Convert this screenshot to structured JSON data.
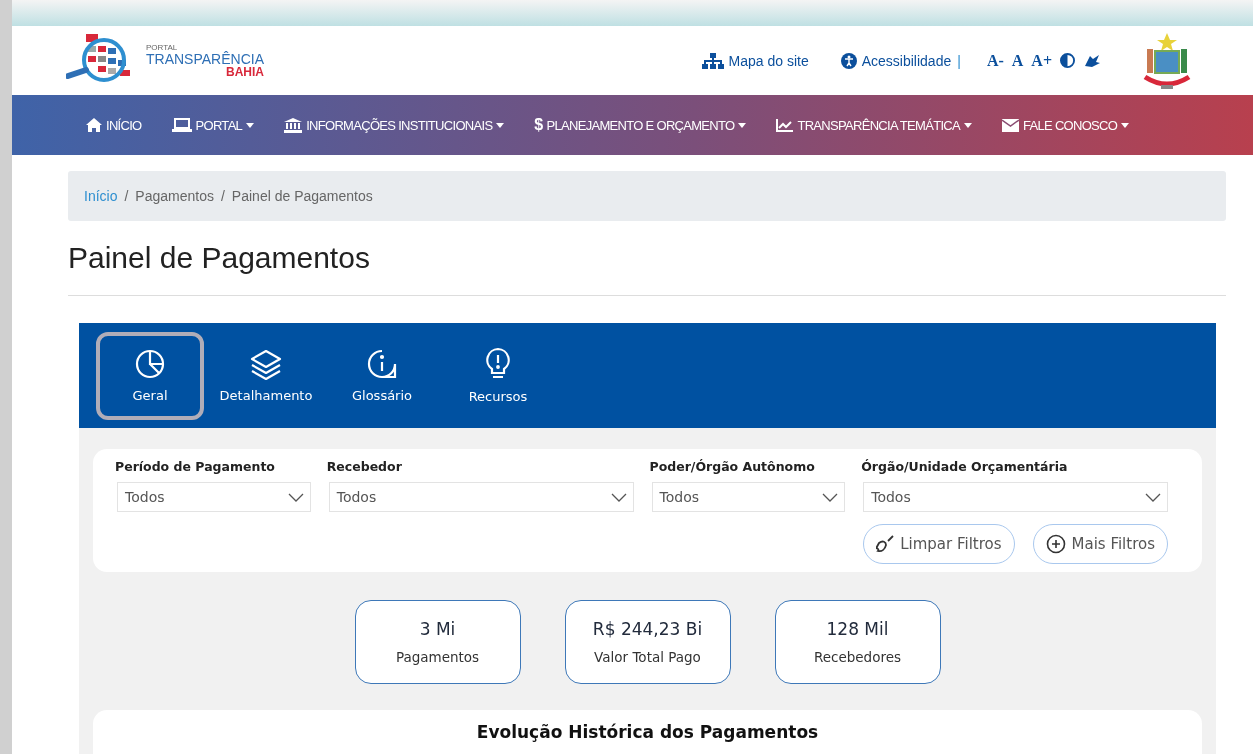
{
  "logo": {
    "small": "PORTAL",
    "main": "TRANSPARÊNCIA",
    "sub": "BAHIA"
  },
  "top_links": [
    {
      "kind": "sitemap",
      "label": "Mapa do site"
    },
    {
      "kind": "accessibility",
      "label": "Acessibilidade"
    }
  ],
  "separator": "|",
  "font_controls": [
    "A-",
    "A",
    "A+"
  ],
  "nav": [
    {
      "kind": "home",
      "label": "INÍCIO",
      "dropdown": false
    },
    {
      "kind": "laptop",
      "label": "PORTAL",
      "dropdown": true
    },
    {
      "kind": "bank",
      "label": "INFORMAÇÕES INSTITUCIONAIS",
      "dropdown": true
    },
    {
      "kind": "dollar",
      "icon": "$",
      "label": "PLANEJAMENTO E ORÇAMENTO",
      "dropdown": true
    },
    {
      "kind": "chart",
      "label": "TRANSPARÊNCIA TEMÁTICA",
      "dropdown": true
    },
    {
      "kind": "mail",
      "label": "FALE CONOSCO",
      "dropdown": true
    }
  ],
  "breadcrumb": [
    "Início",
    "Pagamentos",
    "Painel de Pagamentos"
  ],
  "breadcrumb_separator": "/",
  "page_title": "Painel de Pagamentos",
  "tabs": [
    {
      "kind": "pie",
      "label": "Geral",
      "selected": true
    },
    {
      "kind": "layers",
      "label": "Detalhamento",
      "selected": false
    },
    {
      "kind": "info",
      "label": "Glossário",
      "selected": false
    },
    {
      "kind": "bulb",
      "label": "Recursos",
      "selected": false
    }
  ],
  "filters": [
    {
      "label": "Período de Pagamento",
      "value": "Todos"
    },
    {
      "label": "Recebedor",
      "value": "Todos"
    },
    {
      "label": "Poder/Órgão Autônomo",
      "value": "Todos"
    },
    {
      "label": "Órgão/Unidade Orçamentária",
      "value": "Todos"
    }
  ],
  "filter_buttons": [
    {
      "kind": "broom",
      "label": "Limpar Filtros"
    },
    {
      "kind": "plus",
      "label": "Mais Filtros"
    }
  ],
  "kpis": [
    {
      "value": "3 Mi",
      "label": "Pagamentos"
    },
    {
      "value": "R$ 244,23 Bi",
      "label": "Valor Total Pago"
    },
    {
      "value": "128 Mil",
      "label": "Recebedores"
    }
  ],
  "chart_section": {
    "title": "Evolução Histórica dos Pagamentos"
  }
}
